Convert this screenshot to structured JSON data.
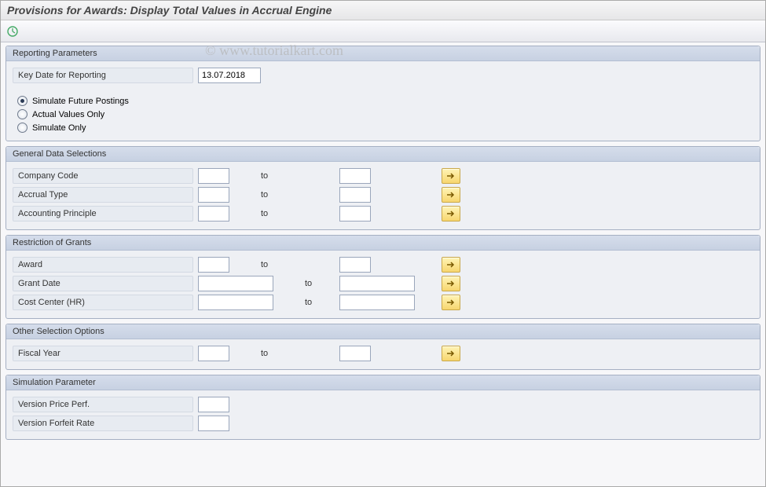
{
  "title": "Provisions for Awards: Display Total Values in Accrual Engine",
  "watermark": "© www.tutorialkart.com",
  "groups": {
    "reporting": {
      "header": "Reporting Parameters",
      "key_date_label": "Key Date for Reporting",
      "key_date_value": "13.07.2018",
      "radio1": "Simulate Future Postings",
      "radio2": "Actual Values Only",
      "radio3": "Simulate Only"
    },
    "general": {
      "header": "General Data Selections",
      "r1": "Company Code",
      "r2": "Accrual Type",
      "r3": "Accounting Principle"
    },
    "grants": {
      "header": "Restriction of Grants",
      "r1": "Award",
      "r2": "Grant Date",
      "r3": "Cost Center (HR)"
    },
    "other": {
      "header": "Other Selection Options",
      "r1": "Fiscal Year"
    },
    "sim": {
      "header": "Simulation Parameter",
      "r1": "Version Price Perf.",
      "r2": "Version Forfeit Rate"
    }
  },
  "to": "to"
}
